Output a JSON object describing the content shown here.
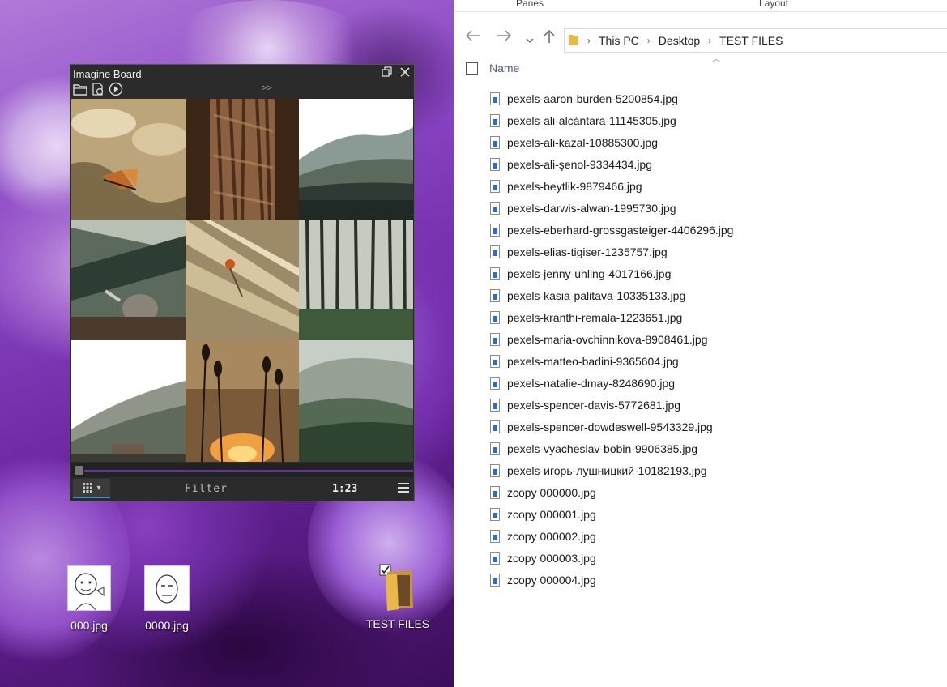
{
  "desktop": {
    "icons": [
      {
        "label": "000.jpg"
      },
      {
        "label": "0000.jpg"
      },
      {
        "label": "TEST FILES"
      }
    ]
  },
  "imagine_board": {
    "title": "Imagine Board",
    "more_label": ">>",
    "filter_placeholder": "Filter",
    "count": "1:23",
    "playback_progress": 0
  },
  "explorer": {
    "ribbon": {
      "panes_label": "Panes",
      "layout_label": "Layout"
    },
    "breadcrumb": [
      "This PC",
      "Desktop",
      "TEST FILES"
    ],
    "column_name": "Name",
    "files": [
      "pexels-aaron-burden-5200854.jpg",
      "pexels-ali-alcántara-11145305.jpg",
      "pexels-ali-kazal-10885300.jpg",
      "pexels-ali-şenol-9334434.jpg",
      "pexels-beytlik-9879466.jpg",
      "pexels-darwis-alwan-1995730.jpg",
      "pexels-eberhard-grossgasteiger-4406296.jpg",
      "pexels-elias-tigiser-1235757.jpg",
      "pexels-jenny-uhling-4017166.jpg",
      "pexels-kasia-palitava-10335133.jpg",
      "pexels-kranthi-remala-1223651.jpg",
      "pexels-maria-ovchinnikova-8908461.jpg",
      "pexels-matteo-badini-9365604.jpg",
      "pexels-natalie-dmay-8248690.jpg",
      "pexels-spencer-davis-5772681.jpg",
      "pexels-spencer-dowdeswell-9543329.jpg",
      "pexels-vyacheslav-bobin-9906385.jpg",
      "pexels-игорь-лушницкий-10182193.jpg",
      "zcopy 000000.jpg",
      "zcopy 000001.jpg",
      "zcopy 000002.jpg",
      "zcopy 000003.jpg",
      "zcopy 000004.jpg"
    ]
  },
  "colors": {
    "accent": "#6a2fa0",
    "folder": "#e8b84a",
    "file_icon": "#2b6fc4"
  }
}
